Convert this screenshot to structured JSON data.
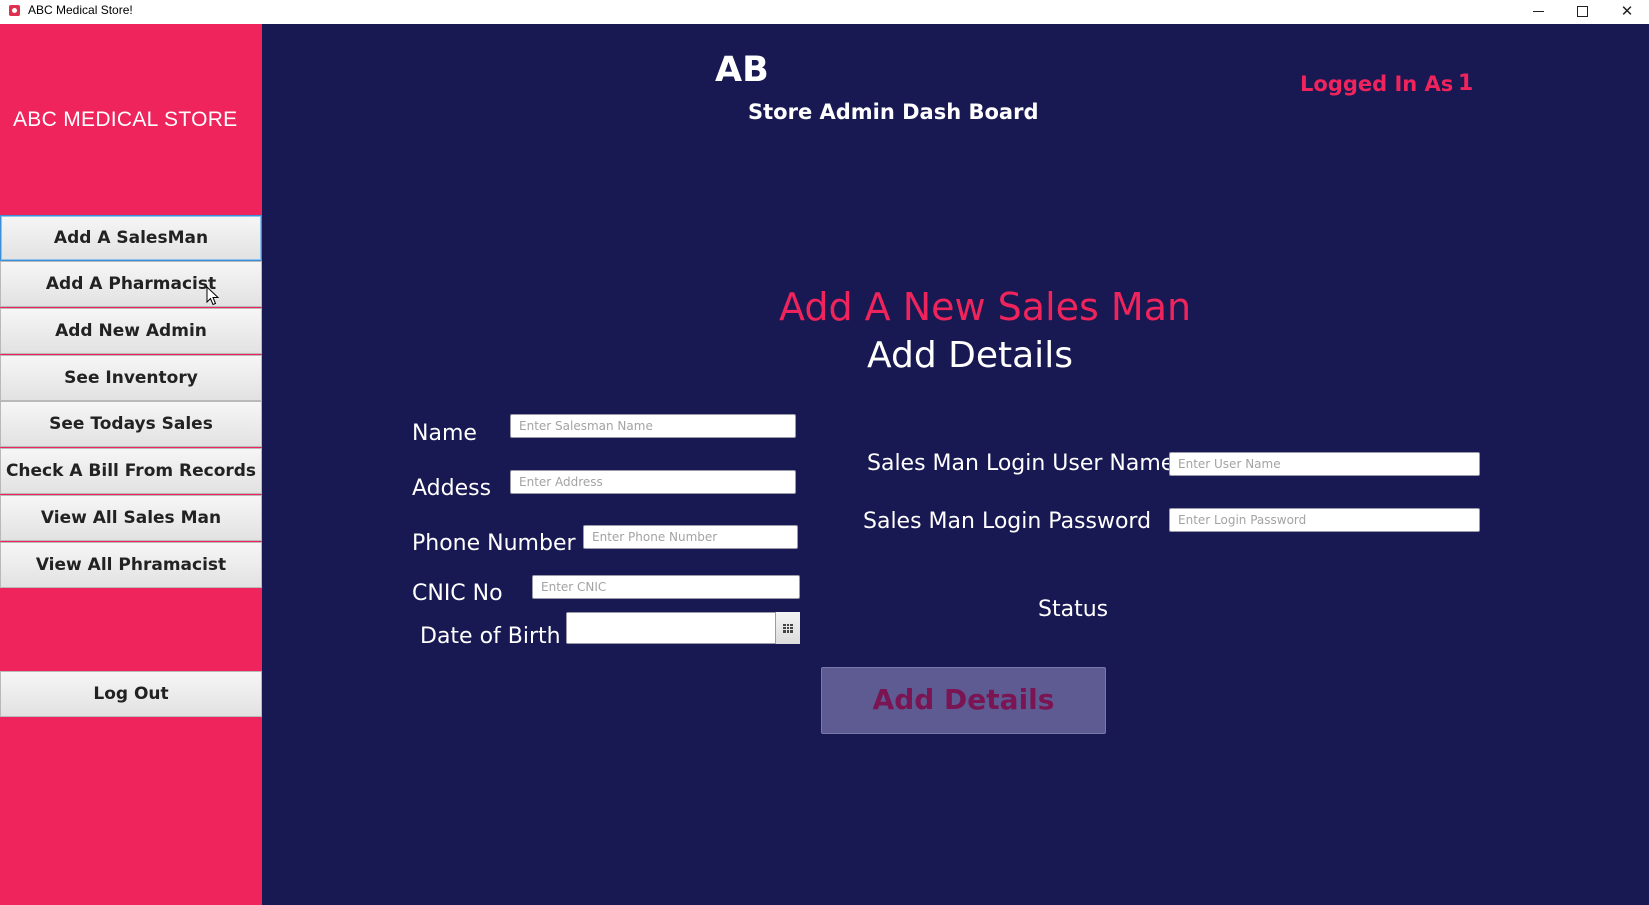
{
  "window": {
    "title": "ABC Medical Store!",
    "minimize_glyph": "",
    "maximize_glyph": "",
    "close_glyph": "✕"
  },
  "sidebar": {
    "store_name": "ABC MEDICAL STORE",
    "items": [
      {
        "label": "Add A SalesMan",
        "active": true
      },
      {
        "label": "Add A Pharmacist",
        "active": false
      },
      {
        "label": "Add New Admin",
        "active": false
      },
      {
        "label": "See Inventory",
        "active": false
      },
      {
        "label": "See Todays Sales",
        "active": false
      },
      {
        "label": "Check A Bill From Records",
        "active": false
      },
      {
        "label": "View All Sales Man",
        "active": false
      },
      {
        "label": "View All  Phramacist",
        "active": false
      }
    ],
    "logout_label": "Log Out"
  },
  "header": {
    "abbreviation": "AB",
    "dashboard_title": "Store Admin Dash Board",
    "logged_in_label": "Logged In As",
    "logged_in_value": "1"
  },
  "form": {
    "title": "Add A New Sales Man",
    "subtitle": "Add Details",
    "name": {
      "label": "Name",
      "placeholder": "Enter Salesman Name",
      "value": ""
    },
    "address": {
      "label": "Addess",
      "placeholder": "Enter Address",
      "value": ""
    },
    "phone": {
      "label": "Phone Number",
      "placeholder": "Enter Phone Number",
      "value": ""
    },
    "cnic": {
      "label": "CNIC No",
      "placeholder": "Enter CNIC",
      "value": ""
    },
    "dob": {
      "label": "Date of Birth",
      "value": ""
    },
    "username": {
      "label": "Sales Man Login User Name",
      "placeholder": "Enter User Name",
      "value": ""
    },
    "password": {
      "label": "Sales Man Login Password",
      "placeholder": "Enter Login Password",
      "value": ""
    },
    "status_label": "Status",
    "submit_label": "Add Details"
  },
  "colors": {
    "sidebar_bg": "#f0245c",
    "main_bg": "#181852",
    "accent": "#f0245c",
    "submit_bg": "#5d5b92",
    "submit_text": "#7a1452"
  },
  "icons": {
    "app": "app-icon",
    "calendar": "calendar-icon",
    "cursor": "mouse-cursor-icon"
  }
}
